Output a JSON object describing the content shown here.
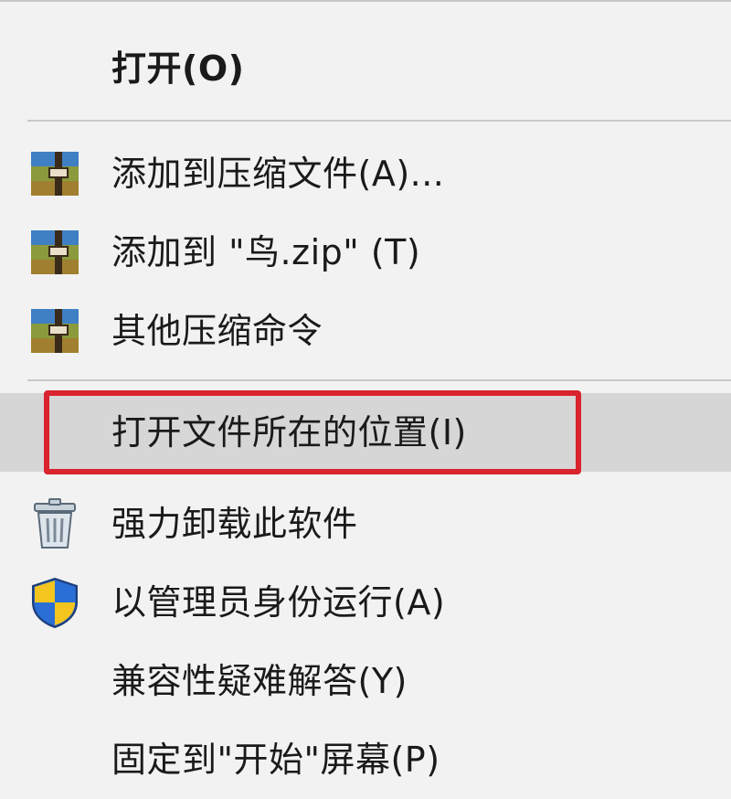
{
  "context_menu": {
    "items": [
      {
        "label": "打开(O)",
        "icon": null
      },
      {
        "label": "添加到压缩文件(A)...",
        "icon": "archive-icon"
      },
      {
        "label": "添加到 \"鸟.zip\" (T)",
        "icon": "archive-icon"
      },
      {
        "label": "其他压缩命令",
        "icon": "archive-icon"
      },
      {
        "label": "打开文件所在的位置(I)",
        "icon": null,
        "highlighted": true
      },
      {
        "label": "强力卸载此软件",
        "icon": "trash-icon"
      },
      {
        "label": "以管理员身份运行(A)",
        "icon": "uac-shield-icon"
      },
      {
        "label": "兼容性疑难解答(Y)",
        "icon": null
      },
      {
        "label": "固定到\"开始\"屏幕(P)",
        "icon": null
      }
    ]
  },
  "colors": {
    "menu_background": "#f2f2f2",
    "hover_background": "#d6d6d6",
    "highlight_border": "#d9232e",
    "separator": "#c9c9c9"
  }
}
